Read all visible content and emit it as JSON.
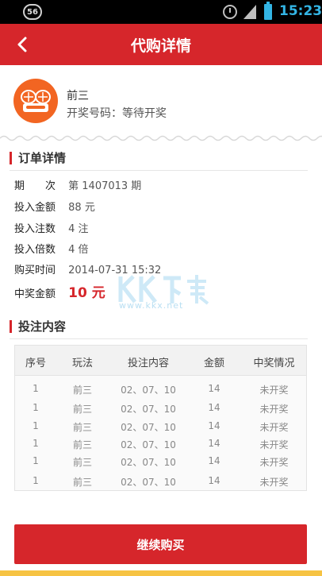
{
  "status_bar": {
    "badge": "56",
    "time": "15:23"
  },
  "header": {
    "title": "代购详情"
  },
  "game": {
    "name": "前三",
    "draw_label": "开奖号码：等待开奖"
  },
  "order": {
    "section_title": "订单详情",
    "rows": [
      {
        "label": "期　　次",
        "value": "第 1407013 期"
      },
      {
        "label": "投入金额",
        "value": "88 元"
      },
      {
        "label": "投入注数",
        "value": "4 注"
      },
      {
        "label": "投入倍数",
        "value": "4 倍"
      },
      {
        "label": "购买时间",
        "value": "2014-07-31 15:32"
      },
      {
        "label": "中奖金额",
        "value": "10 元"
      }
    ]
  },
  "watermark": {
    "text": "www.kkx.net"
  },
  "bets": {
    "section_title": "投注内容",
    "headers": [
      "序号",
      "玩法",
      "投注内容",
      "金额",
      "中奖情况"
    ],
    "rows": [
      [
        "1",
        "前三",
        "02、07、10",
        "14",
        "未开奖"
      ],
      [
        "1",
        "前三",
        "02、07、10",
        "14",
        "未开奖"
      ],
      [
        "1",
        "前三",
        "02、07、10",
        "14",
        "未开奖"
      ],
      [
        "1",
        "前三",
        "02、07、10",
        "14",
        "未开奖"
      ],
      [
        "1",
        "前三",
        "02、07、10",
        "14",
        "未开奖"
      ],
      [
        "1",
        "前三",
        "02、07、10",
        "14",
        "未开奖"
      ]
    ]
  },
  "actions": {
    "continue_label": "继续购买"
  },
  "colors": {
    "brand_red": "#d6262b",
    "icon_orange": "#f26522",
    "status_blue": "#33b5e5"
  }
}
